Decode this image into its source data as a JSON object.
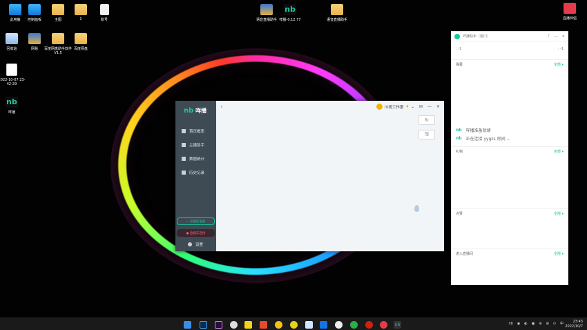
{
  "desktop": {
    "icons": [
      {
        "label": "此电脑",
        "kind": "pc"
      },
      {
        "label": "控制面板",
        "kind": "pc"
      },
      {
        "label": "主图",
        "kind": "folder"
      },
      {
        "label": "1",
        "kind": "folder"
      },
      {
        "label": "账号",
        "kind": "file"
      },
      {
        "label": "回收站",
        "kind": "recycle"
      },
      {
        "label": "网易",
        "kind": "archive"
      },
      {
        "label": "百度网盘助手软件V1.5",
        "kind": "folder"
      },
      {
        "label": "百度网盘",
        "kind": "folder"
      },
      {
        "label": "2022-10-07 23-42-29",
        "kind": "mp4"
      },
      {
        "label": "咩播",
        "kind": "nb"
      },
      {
        "label": "语音直播助手",
        "kind": "archive"
      },
      {
        "label": "咩播-0.12.77",
        "kind": "nb"
      },
      {
        "label": "语音直播助手",
        "kind": "folder"
      },
      {
        "label": "直播伴侣",
        "kind": "red"
      }
    ]
  },
  "app": {
    "logo_glyph": "nb",
    "logo_text": "咩播",
    "nav": [
      "首页概率",
      "主播助手",
      "数据统计",
      "历史记录"
    ],
    "open_btn": "✓ 开播前准备",
    "live_btn": "● 直播未连接",
    "settings": "设置",
    "studio": "川视工作室",
    "back": "‹",
    "controls": [
      "⊟",
      "—",
      "✕"
    ],
    "refresh": "↻",
    "save": "🖫"
  },
  "panel": {
    "title": "咩播助手（窗口）",
    "controls": [
      "⊤",
      "—",
      "✕"
    ],
    "top_left": ": -1",
    "top_right": ": -1",
    "sections": [
      {
        "title": "弹幕",
        "filter": "全部 ▾"
      },
      {
        "title": "礼物",
        "filter": "全部 ▾"
      },
      {
        "title": "点赞",
        "filter": "全部 ▾"
      },
      {
        "title": "进入直播间",
        "filter": "全部 ▾"
      }
    ],
    "messages": [
      "咩播准备就绪",
      "正在连接 yygzs 房间 ..."
    ]
  },
  "taskbar": {
    "tray": [
      "nb",
      "◉",
      "◐",
      "▣",
      "⊕",
      "⊞",
      "⊙",
      "中"
    ],
    "time": "23:43",
    "date": "2022/10/7"
  }
}
